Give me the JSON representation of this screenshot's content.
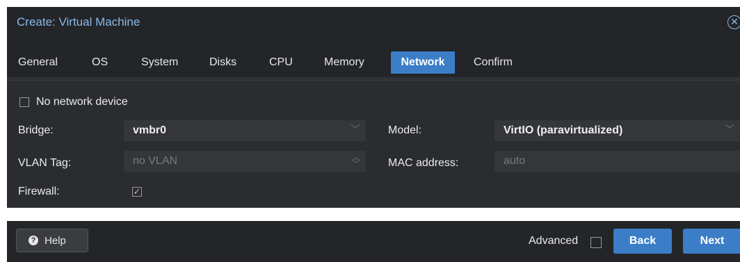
{
  "window": {
    "title": "Create: Virtual Machine"
  },
  "tabs": [
    {
      "label": "General"
    },
    {
      "label": "OS"
    },
    {
      "label": "System"
    },
    {
      "label": "Disks"
    },
    {
      "label": "CPU"
    },
    {
      "label": "Memory"
    },
    {
      "label": "Network",
      "active": true
    },
    {
      "label": "Confirm"
    }
  ],
  "form": {
    "no_network_device": {
      "label": "No network device",
      "checked": false
    },
    "bridge": {
      "label": "Bridge:",
      "value": "vmbr0"
    },
    "vlan_tag": {
      "label": "VLAN Tag:",
      "placeholder": "no VLAN"
    },
    "firewall": {
      "label": "Firewall:",
      "checked": true
    },
    "model": {
      "label": "Model:",
      "value": "VirtIO (paravirtualized)"
    },
    "mac_address": {
      "label": "MAC address:",
      "placeholder": "auto"
    }
  },
  "footer": {
    "help_label": "Help",
    "advanced_label": "Advanced",
    "advanced_checked": false,
    "back_label": "Back",
    "next_label": "Next"
  },
  "colors": {
    "accent": "#3b7ec7",
    "title_text": "#8ab8e8",
    "background": "#232528"
  }
}
